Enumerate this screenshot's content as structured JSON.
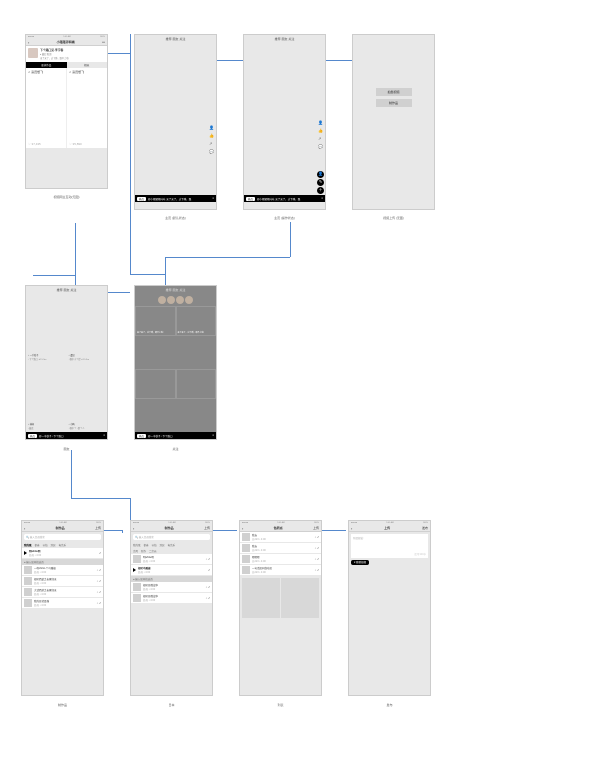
{
  "status": {
    "carrier": "Sketch",
    "signal": "●●●●●",
    "time": "9:41 AM",
    "battery": "100%"
  },
  "r1": {
    "s1": {
      "title": "小猪猪评科幽",
      "userline": "下个路口见-李宇春",
      "userinfo": "● 藏起 阳湖",
      "desc": "来了来了，过下蹲，跟不上啦!",
      "tab1": "更多作品",
      "tab2": "相似",
      "item1": "♫ 演员想飞",
      "item2": "♫ 演员想飞",
      "count1": "♡ 37,435",
      "count2": "♡ 35,890",
      "label": "视频网主互动(无图)"
    },
    "s2": {
      "tabs": "推荐 朋友 关注",
      "footer_tag": "热点",
      "footer_txt": "@小猪猪猪咔咔 来了来了，过下蹲，跟",
      "label": "主页 (默认状态)",
      "icon_user": "👤",
      "icon_like": "👍",
      "icon_share": "↗",
      "icon_comment": "💬"
    },
    "s3": {
      "tabs": "推荐 朋友 关注",
      "footer_tag": "热点",
      "footer_txt": "@小猪猪猪咔咔 来了来了，过下蹲，跟",
      "label": "主页 (操作状态)",
      "b1": "👤",
      "b2": "✎",
      "b3": "＋"
    },
    "s4": {
      "btn1": "拍摄视频",
      "btn2": "制作品",
      "label": "视频上传 (无图)"
    }
  },
  "r2": {
    "s1": {
      "tabs": "推荐 朋友 关注",
      "c1_t": "♪ 一千秒子",
      "c1_b": "↓下个路口  ⬈15.5m",
      "c2_t": "♪ 遇见",
      "c2_b": "↓偶尔小个撑  ⬈15.5m",
      "c3_t": "♪ 林间",
      "c3_b": "↓藏底",
      "c4_t": "♪ 小鸭",
      "c4_b": "↓偶尔个  ↓那个人",
      "footer_tag": "热点",
      "footer_txt": "@一千秒子 ↓下个路口",
      "label": "朋友"
    },
    "s2": {
      "tabs": "推荐 朋友 关注",
      "g1": "来了来了，过下蹲，跟不上啦!",
      "g2": "来了来了，过下蹲，跟不上啦!",
      "g3": "",
      "g4": "",
      "footer_tag": "热点",
      "footer_txt": "@一千秒子 ↓下个路口",
      "label": "关注"
    }
  },
  "r3": {
    "s1": {
      "title": "制作品",
      "right": "上传",
      "search": "🔍 输入音调搜索",
      "cats_active": "我的歌",
      "cats": [
        "参奏",
        "节拍",
        "涂层",
        "电音乐"
      ],
      "now_t": "明white明",
      "now_s": "舒昌 • 4:00",
      "sec": "● 输入居同找这首",
      "i1_t": "一吻christ-个鸟瞰编",
      "i1_s": "舒昌 • 4:00",
      "i2_t": "视听西遊之长尾归来",
      "i2_s": "舒昌 • 4:00",
      "i3_t": "大话西游之长尾归来",
      "i3_s": "舒昌 • 4:00",
      "i4_t": "我的日式盃弹",
      "i4_s": "舒昌 • 4:00",
      "label": "制作品"
    },
    "s2": {
      "title": "制作品",
      "right": "上传",
      "search": "🔍 输入音调搜索",
      "cats1": [
        "我的歌",
        "参奏",
        "节拍",
        "涂层",
        "电音乐"
      ],
      "cats2": [
        "古风",
        "新作",
        "二次元"
      ],
      "i1_t": "明white明",
      "i1_s": "舒昌 • 4:00",
      "i2_t": "视听鸟瞰编",
      "i2_s": "舒昌 • 4:00",
      "sec2": "● 输入居同找这首",
      "i3_t": "视听日俄战争",
      "i3_s": "舒昌 • 4:00",
      "i4_t": "视听日俄战争",
      "i4_s": "舒昌 • 4:00",
      "label": "日本"
    },
    "s3": {
      "title": "色药派",
      "right": "上传",
      "i1_t": "我去",
      "i1_s": "总223 • 4:00",
      "i2_t": "",
      "i3_t": "嗯嗯嗯",
      "i3_s": "总223 • 4:00",
      "i4_t": "一句话居同找哇居",
      "i4_s": "总223 • 4:00",
      "label": "列表"
    },
    "s4": {
      "title": "上传",
      "right": "发布",
      "line": "你还想说:",
      "count": "还可100字",
      "tag": "♥ 随他想想",
      "label": "发布"
    }
  }
}
